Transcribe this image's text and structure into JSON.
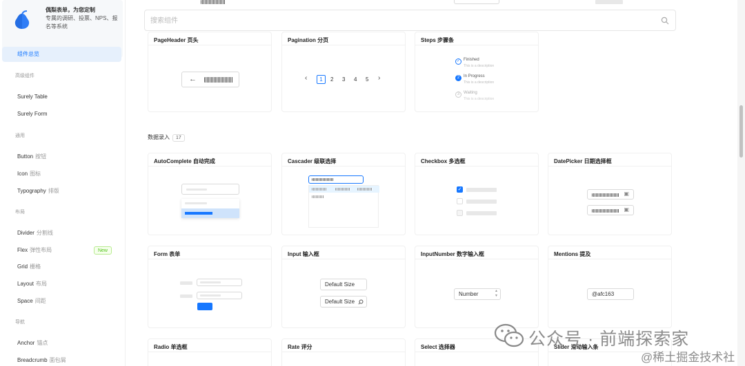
{
  "brand": {
    "line1": "偶梨表单，为您定制",
    "line2": "专属的调研、投票、NPS、报名等系统"
  },
  "sidebar": {
    "overview": "组件总览",
    "groups": {
      "advanced": "高级组件",
      "general": "通用",
      "layout": "布局",
      "navigation": "导航"
    },
    "items": {
      "surely_table": "Surely Table",
      "surely_form": "Surely Form",
      "button": {
        "label": "Button",
        "sub": "按钮"
      },
      "icon": {
        "label": "Icon",
        "sub": "图标"
      },
      "typography": {
        "label": "Typography",
        "sub": "排版"
      },
      "divider": {
        "label": "Divider",
        "sub": "分割线"
      },
      "flex": {
        "label": "Flex",
        "sub": "弹性布局",
        "badge": "New"
      },
      "grid": {
        "label": "Grid",
        "sub": "栅格"
      },
      "layout": {
        "label": "Layout",
        "sub": "布局"
      },
      "space": {
        "label": "Space",
        "sub": "间距"
      },
      "anchor": {
        "label": "Anchor",
        "sub": "锚点"
      },
      "breadcrumb": {
        "label": "Breadcrumb",
        "sub": "面包屑"
      }
    }
  },
  "search": {
    "placeholder": "搜索组件"
  },
  "navigation_cards": {
    "pageheader": "PageHeader 页头",
    "pagination": "Pagination 分页",
    "pagination_pages": [
      "1",
      "2",
      "3",
      "4",
      "5"
    ],
    "steps": "Steps 步骤条",
    "steps_items": [
      {
        "title": "Finished",
        "desc": "This is a description"
      },
      {
        "title": "In Progress",
        "desc": "This is a description"
      },
      {
        "title": "Waiting",
        "desc": "This is a description"
      }
    ]
  },
  "data_entry": {
    "title": "数据录入",
    "count": "17",
    "cards": {
      "autocomplete": "AutoComplete 自动完成",
      "cascader": "Cascader 级联选择",
      "checkbox": "Checkbox 多选框",
      "datepicker": "DatePicker 日期选择框",
      "form": "Form 表单",
      "input": "Input 输入框",
      "inputnumber": "InputNumber 数字输入框",
      "mentions": "Mentions 提及",
      "radio": "Radio 单选框",
      "rate": "Rate 评分",
      "select": "Select 选择器",
      "slider": "Slider 滑动输入条"
    },
    "input_default": "Default Size",
    "input_search": "Default Size",
    "number_value": "Number",
    "mentions_value": "@afc163"
  },
  "watermark": {
    "line1": "公众号 · 前端探索家",
    "line2": "@稀土掘金技术社区"
  },
  "colors": {
    "accent": "#1677ff",
    "new_badge": "#52c41a"
  }
}
